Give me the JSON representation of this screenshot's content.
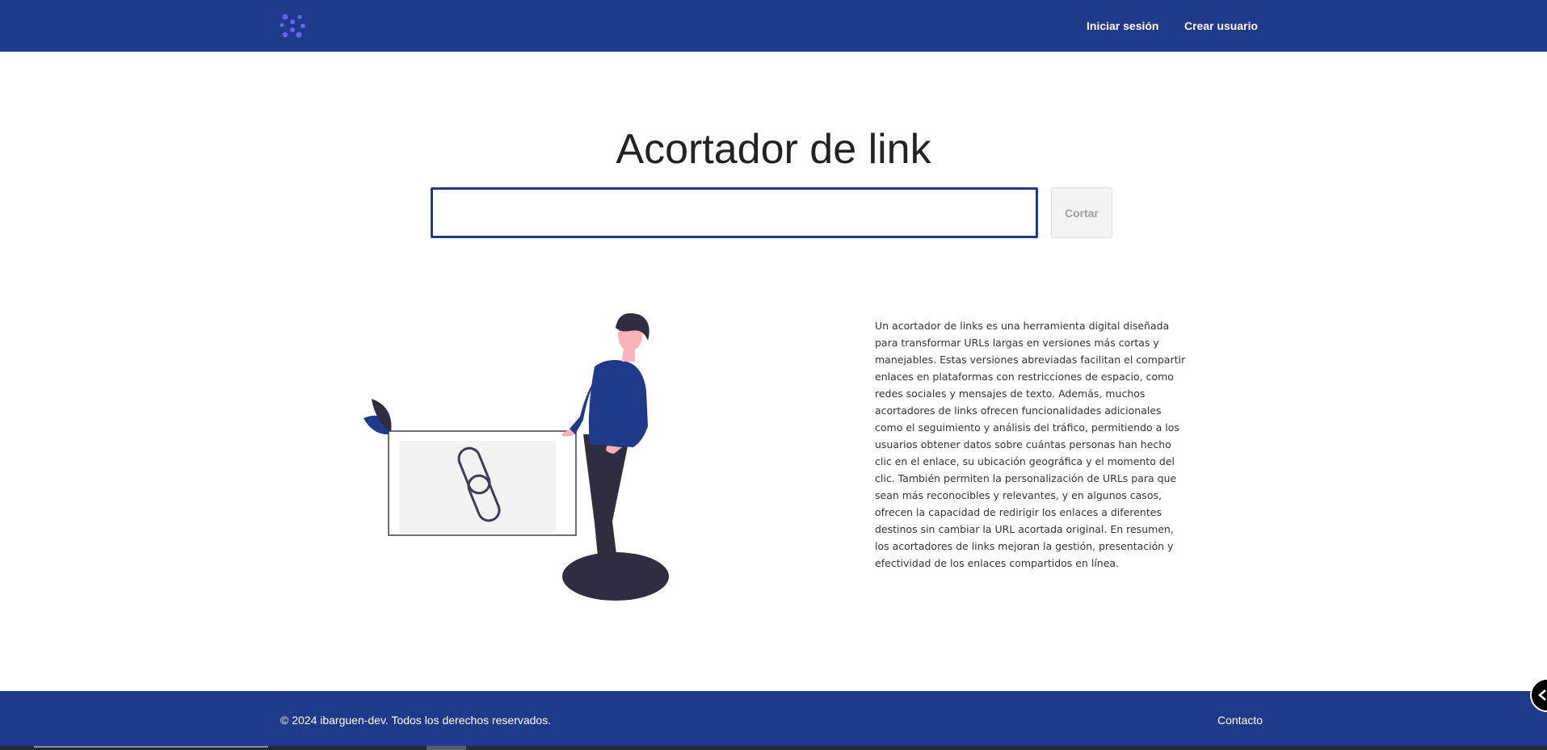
{
  "navbar": {
    "logo_icon": "molecule-logo-icon",
    "links": [
      {
        "label": "Iniciar sesión"
      },
      {
        "label": "Crear usuario"
      }
    ]
  },
  "main": {
    "title": "Acortador de link",
    "input": {
      "value": "",
      "placeholder": ""
    },
    "cut_button": "Cortar",
    "description": "Un acortador de links es una herramienta digital diseñada para transformar URLs largas en versiones más cortas y manejables. Estas versiones abreviadas facilitan el compartir enlaces en plataformas con restricciones de espacio, como redes sociales y mensajes de texto. Además, muchos acortadores de links ofrecen funcionalidades adicionales como el seguimiento y análisis del tráfico, permitiendo a los usuarios obtener datos sobre cuántas personas han hecho clic en el enlace, su ubicación geográfica y el momento del clic. También permiten la personalización de URLs para que sean más reconocibles y relevantes, y en algunos casos, ofrecen la capacidad de redirigir los enlaces a diferentes destinos sin cambiar la URL acortada original. En resumen, los acortadores de links mejoran la gestión, presentación y efectividad de los enlaces compartidos en línea.",
    "illustration": "person-with-link-illustration"
  },
  "footer": {
    "copyright": "© 2024 ibarguen-dev. Todos los derechos reservados.",
    "contact": "Contacto"
  },
  "floating_button_icon": "chevron-left-icon",
  "colors": {
    "brand": "#1f3a8a",
    "logo": "#6366f1",
    "button_bg": "#f3f3f3",
    "button_text": "#9e9e9e"
  }
}
